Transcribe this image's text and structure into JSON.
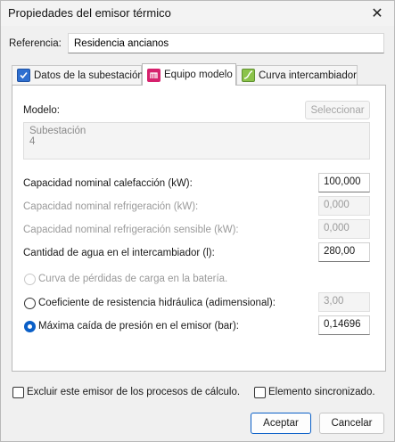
{
  "window": {
    "title": "Propiedades del emisor térmico",
    "close_glyph": "✕"
  },
  "referencia": {
    "label": "Referencia:",
    "value": "Residencia ancianos"
  },
  "tabs": [
    {
      "label": "Datos de la subestación",
      "icon": "checkbox-blue-icon"
    },
    {
      "label": "Equipo modelo",
      "icon": "magenta-logo-icon",
      "active": true
    },
    {
      "label": "Curva intercambiador",
      "icon": "green-curve-icon"
    }
  ],
  "panel": {
    "modelo_label": "Modelo:",
    "seleccionar_label": "Seleccionar",
    "model_desc_line1": "Subestación",
    "model_desc_line2": "4",
    "capacidad_calef_label": "Capacidad nominal calefacción (kW):",
    "capacidad_calef_value": "100,000",
    "capacidad_refrig_label": "Capacidad nominal refrigeración (kW):",
    "capacidad_refrig_value": "0,000",
    "capacidad_refrig_sens_label": "Capacidad nominal refrigeración sensible (kW):",
    "capacidad_refrig_sens_value": "0,000",
    "cantidad_agua_label": "Cantidad de agua en el intercambiador (l):",
    "cantidad_agua_value": "280,00",
    "curva_perdidas_label": "Curva de pérdidas de carga en la batería.",
    "coef_resist_label": "Coeficiente de resistencia hidráulica (adimensional):",
    "coef_resist_value": "3,00",
    "max_caida_label": "Máxima caída de presión en el emisor (bar):",
    "max_caida_value": "0,14696"
  },
  "footer": {
    "excluir_label": "Excluir este emisor de los procesos de cálculo.",
    "sincronizado_label": "Elemento sincronizado.",
    "aceptar_label": "Aceptar",
    "cancelar_label": "Cancelar"
  },
  "colors": {
    "accent": "#0a5fc7",
    "tab_magenta": "#d6216d",
    "tab_blue": "#2e6fd0",
    "tab_green": "#8bc34a"
  }
}
